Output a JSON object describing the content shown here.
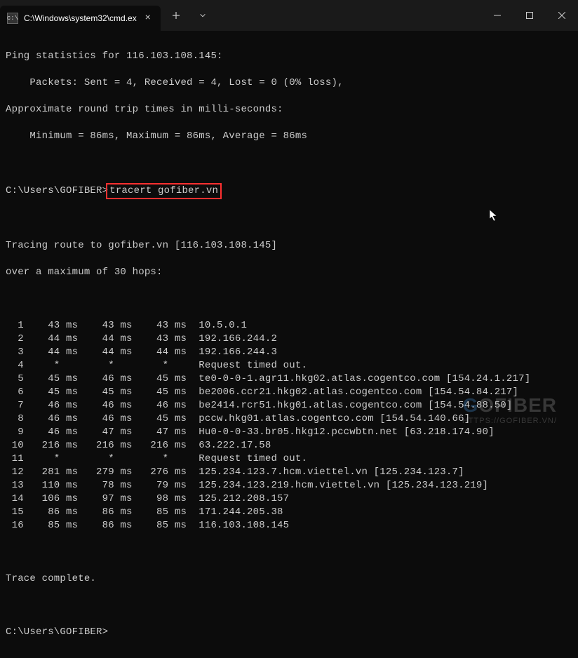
{
  "titlebar": {
    "tab_title": "C:\\Windows\\system32\\cmd.ex",
    "tab_icon_char": "c:\\"
  },
  "output": {
    "ping_header": "Ping statistics for 116.103.108.145:",
    "ping_packets": "    Packets: Sent = 4, Received = 4, Lost = 0 (0% loss),",
    "approx": "Approximate round trip times in milli-seconds:",
    "minmax": "    Minimum = 86ms, Maximum = 86ms, Average = 86ms",
    "prompt1": "C:\\Users\\GOFIBER>",
    "cmd": "tracert gofiber.vn",
    "tracing1": "Tracing route to gofiber.vn [116.103.108.145]",
    "tracing2": "over a maximum of 30 hops:",
    "hops": [
      "  1    43 ms    43 ms    43 ms  10.5.0.1",
      "  2    44 ms    44 ms    43 ms  192.166.244.2",
      "  3    44 ms    44 ms    44 ms  192.166.244.3",
      "  4     *        *        *     Request timed out.",
      "  5    45 ms    46 ms    45 ms  te0-0-0-1.agr11.hkg02.atlas.cogentco.com [154.24.1.217]",
      "  6    45 ms    45 ms    45 ms  be2006.ccr21.hkg02.atlas.cogentco.com [154.54.84.217]",
      "  7    46 ms    46 ms    46 ms  be2414.rcr51.hkg01.atlas.cogentco.com [154.54.88.50]",
      "  8    46 ms    46 ms    45 ms  pccw.hkg01.atlas.cogentco.com [154.54.140.66]",
      "  9    46 ms    47 ms    47 ms  Hu0-0-0-33.br05.hkg12.pccwbtn.net [63.218.174.90]",
      " 10   216 ms   216 ms   216 ms  63.222.17.58",
      " 11     *        *        *     Request timed out.",
      " 12   281 ms   279 ms   276 ms  125.234.123.7.hcm.viettel.vn [125.234.123.7]",
      " 13   110 ms    78 ms    79 ms  125.234.123.219.hcm.viettel.vn [125.234.123.219]",
      " 14   106 ms    97 ms    98 ms  125.212.208.157",
      " 15    86 ms    86 ms    85 ms  171.244.205.38",
      " 16    85 ms    86 ms    85 ms  116.103.108.145"
    ],
    "complete": "Trace complete.",
    "prompt2": "C:\\Users\\GOFIBER>"
  },
  "watermark": {
    "brand": "GOFIBER",
    "url": "HTTPS://GOFIBER.VN/"
  }
}
